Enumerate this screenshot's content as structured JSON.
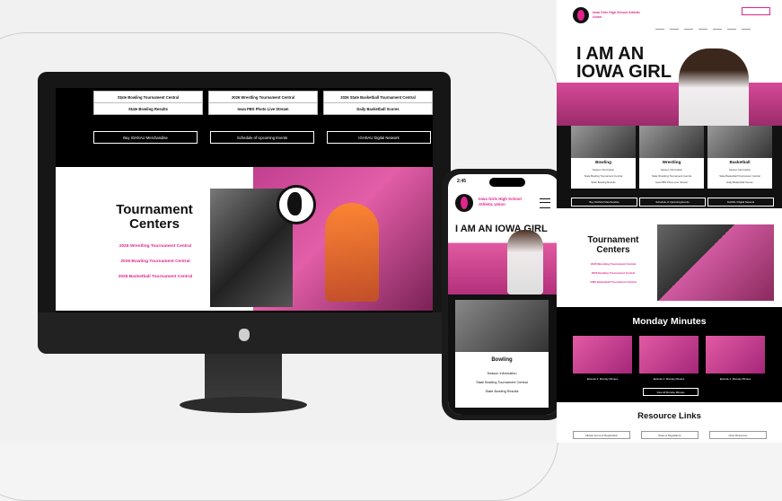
{
  "desktop": {
    "top_buttons": [
      "State Bowling Tournament Central",
      "2026 Wrestling Tournament Central",
      "2026 State Basketball Tournament Central"
    ],
    "second_buttons": [
      "State Bowling Results",
      "Iowa PBS Photo Live Stream",
      "Daily Basketball Scores"
    ],
    "dark_buttons": [
      "Buy IGHSAU Merchandise",
      "Schedule of Upcoming Events",
      "IGHSAU Digital Network"
    ],
    "tournament": {
      "title": "Tournament Centers",
      "links": [
        "2026 Wrestling Tournament Central",
        "2026 Bowling Tournament Central",
        "2026 Basketball Tournament Central"
      ]
    }
  },
  "phone": {
    "time": "2:45",
    "org_name": "Iowa Girls High School Athletic Union",
    "hero_title": "I AM AN IOWA GIRL",
    "card": {
      "heading": "Bowling",
      "links": [
        "Season Information",
        "State Bowling Tournament Central",
        "State Bowling Results"
      ]
    }
  },
  "page": {
    "org_name": "Iowa Girls High School Athletic Union",
    "hero_title": "I AM AN IOWA GIRL",
    "cards": [
      {
        "heading": "Bowling",
        "links": [
          "Season Information",
          "State Bowling Tournament Central",
          "State Bowling Results"
        ]
      },
      {
        "heading": "Wrestling",
        "links": [
          "Season Information",
          "State Wrestling Tournament Central",
          "Iowa PBS Photo Live Stream"
        ]
      },
      {
        "heading": "Basketball",
        "links": [
          "Season Information",
          "State Basketball Tournament Central",
          "Daily Basketball Scores"
        ]
      }
    ],
    "strip_buttons": [
      "Buy IGHSAU Merchandise",
      "Schedule of Upcoming Events",
      "IGHSAU Digital Network"
    ],
    "tournament_title": "Tournament Centers",
    "tournament_links": [
      "2026 Wrestling Tournament Central",
      "2026 Bowling Tournament Central",
      "2026 Basketball Tournament Central"
    ],
    "monday_title": "Monday Minutes",
    "monday_captions": [
      "Episode 3: Monday Minutes",
      "Episode 2: Monday Minutes",
      "Episode 1: Monday Minutes"
    ],
    "monday_button": "View All Monday Minutes",
    "resources_title": "Resource Links",
    "resources_buttons": [
      "Athletic Forms & Registration",
      "Rules & Regulations",
      "Clinic Resources"
    ]
  },
  "colors": {
    "accent": "#e0258b",
    "dark": "#111111"
  }
}
